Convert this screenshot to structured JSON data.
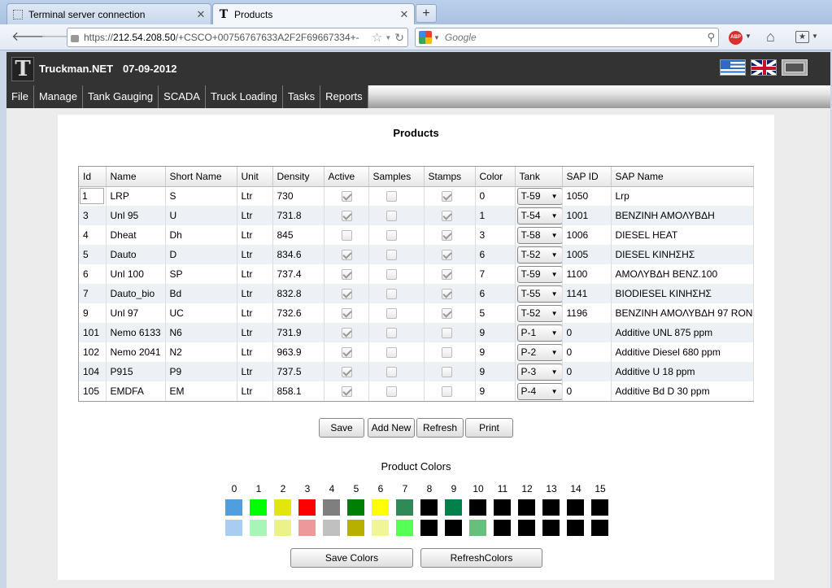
{
  "browser": {
    "tabs": [
      {
        "label": "Terminal server connection",
        "active": false
      },
      {
        "label": "Products",
        "active": true
      }
    ],
    "new_tab": "+",
    "url_prefix": "https://",
    "url_host": "212.54.208.50",
    "url_rest": "/+CSCO+00756767633A2F2F69667334+-",
    "search_placeholder": "Google"
  },
  "app": {
    "title": "Truckman.NET",
    "date": "07-09-2012",
    "menu": [
      "File",
      "Manage",
      "Tank Gauging",
      "SCADA",
      "Truck Loading",
      "Tasks",
      "Reports"
    ]
  },
  "products": {
    "title": "Products",
    "columns": [
      "Id",
      "Name",
      "Short Name",
      "Unit",
      "Density",
      "Active",
      "Samples",
      "Stamps",
      "Color",
      "Tank",
      "SAP ID",
      "SAP Name"
    ],
    "rows": [
      {
        "id": "1",
        "name": "LRP",
        "short": "S",
        "unit": "Ltr",
        "density": "730",
        "active": true,
        "samples": false,
        "stamps": true,
        "color": "0",
        "tank": "T-59",
        "sap_id": "1050",
        "sap_name": "Lrp"
      },
      {
        "id": "3",
        "name": "Unl 95",
        "short": "U",
        "unit": "Ltr",
        "density": "731.8",
        "active": true,
        "samples": false,
        "stamps": true,
        "color": "1",
        "tank": "T-54",
        "sap_id": "1001",
        "sap_name": "ΒΕΝΖΙΝΗ ΑΜΟΛΥΒΔΗ"
      },
      {
        "id": "4",
        "name": "Dheat",
        "short": "Dh",
        "unit": "Ltr",
        "density": "845",
        "active": false,
        "samples": false,
        "stamps": true,
        "color": "3",
        "tank": "T-58",
        "sap_id": "1006",
        "sap_name": "DIESEL HEAT"
      },
      {
        "id": "5",
        "name": "Dauto",
        "short": "D",
        "unit": "Ltr",
        "density": "834.6",
        "active": true,
        "samples": false,
        "stamps": true,
        "color": "6",
        "tank": "T-52",
        "sap_id": "1005",
        "sap_name": "DIESEL ΚΙΝΗΣΗΣ"
      },
      {
        "id": "6",
        "name": "Unl 100",
        "short": "SP",
        "unit": "Ltr",
        "density": "737.4",
        "active": true,
        "samples": false,
        "stamps": true,
        "color": "7",
        "tank": "T-59",
        "sap_id": "1100",
        "sap_name": "ΑΜΟΛΥΒΔΗ ΒΕΝΖ.100"
      },
      {
        "id": "7",
        "name": "Dauto_bio",
        "short": "Bd",
        "unit": "Ltr",
        "density": "832.8",
        "active": true,
        "samples": false,
        "stamps": true,
        "color": "6",
        "tank": "T-55",
        "sap_id": "1141",
        "sap_name": "BIODIESEL ΚΙΝΗΣΗΣ"
      },
      {
        "id": "9",
        "name": "Unl 97",
        "short": "UC",
        "unit": "Ltr",
        "density": "732.6",
        "active": true,
        "samples": false,
        "stamps": true,
        "color": "5",
        "tank": "T-52",
        "sap_id": "1196",
        "sap_name": "ΒΕΝΖΙΝΗ ΑΜΟΛΥΒΔΗ 97 RON"
      },
      {
        "id": "101",
        "name": "Nemo 6133",
        "short": "N6",
        "unit": "Ltr",
        "density": "731.9",
        "active": true,
        "samples": false,
        "stamps": false,
        "color": "9",
        "tank": "P-1",
        "sap_id": "0",
        "sap_name": "Additive UNL 875 ppm"
      },
      {
        "id": "102",
        "name": "Nemo 2041",
        "short": "N2",
        "unit": "Ltr",
        "density": "963.9",
        "active": true,
        "samples": false,
        "stamps": false,
        "color": "9",
        "tank": "P-2",
        "sap_id": "0",
        "sap_name": "Additive Diesel 680 ppm"
      },
      {
        "id": "104",
        "name": "P915",
        "short": "P9",
        "unit": "Ltr",
        "density": "737.5",
        "active": true,
        "samples": false,
        "stamps": false,
        "color": "9",
        "tank": "P-3",
        "sap_id": "0",
        "sap_name": "Additive U 18 ppm"
      },
      {
        "id": "105",
        "name": "EMDFA",
        "short": "EM",
        "unit": "Ltr",
        "density": "858.1",
        "active": true,
        "samples": false,
        "stamps": false,
        "color": "9",
        "tank": "P-4",
        "sap_id": "0",
        "sap_name": "Additive Bd D 30 ppm"
      }
    ],
    "buttons": {
      "save": "Save",
      "add_new": "Add New",
      "refresh": "Refresh",
      "print": "Print"
    }
  },
  "product_colors": {
    "title": "Product Colors",
    "indices": [
      "0",
      "1",
      "2",
      "3",
      "4",
      "5",
      "6",
      "7",
      "8",
      "9",
      "10",
      "11",
      "12",
      "13",
      "14",
      "15"
    ],
    "primary": [
      "#4f9ee0",
      "#00ff00",
      "#e3e60a",
      "#ff0000",
      "#7f7f7f",
      "#007f00",
      "#ffff00",
      "#2e8b57",
      "#000000",
      "#00804a",
      "#000000",
      "#000000",
      "#000000",
      "#000000",
      "#000000",
      "#000000"
    ],
    "secondary": [
      "#a8ccf2",
      "#a8f5b8",
      "#ebf28c",
      "#ee9999",
      "#c0c0c0",
      "#b7b000",
      "#f1f59a",
      "#55ff55",
      "#000000",
      "#000000",
      "#66c07c",
      "#000000",
      "#000000",
      "#000000",
      "#000000",
      "#000000"
    ],
    "buttons": {
      "save": "Save Colors",
      "refresh": "RefreshColors"
    }
  }
}
